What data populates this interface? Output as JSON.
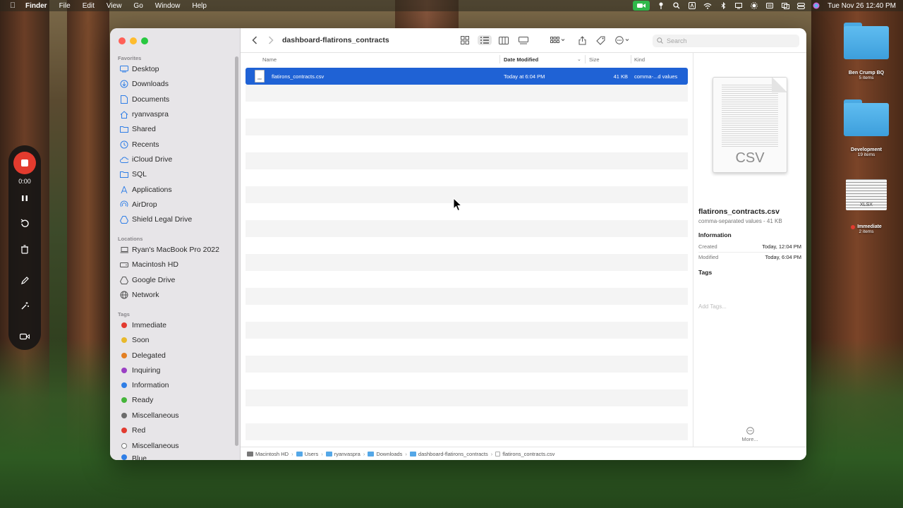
{
  "menubar": {
    "app": "Finder",
    "items": [
      "File",
      "Edit",
      "View",
      "Go",
      "Window",
      "Help"
    ],
    "clock": "Tue Nov 26  12:40 PM"
  },
  "recorder": {
    "timer": "0:00"
  },
  "finder": {
    "sidebar": {
      "favorites_header": "Favorites",
      "favorites": [
        "Desktop",
        "Downloads",
        "Documents",
        "ryanvaspra",
        "Shared",
        "Recents",
        "iCloud Drive",
        "SQL",
        "Applications",
        "AirDrop",
        "Shield Legal Drive"
      ],
      "locations_header": "Locations",
      "locations": [
        "Ryan's MacBook Pro 2022",
        "Macintosh HD",
        "Google Drive",
        "Network"
      ],
      "tags_header": "Tags",
      "tags": [
        {
          "label": "Immediate",
          "color": "#e23b30"
        },
        {
          "label": "Soon",
          "color": "#e8b92c"
        },
        {
          "label": "Delegated",
          "color": "#e37f22"
        },
        {
          "label": "Inquiring",
          "color": "#9b40c4"
        },
        {
          "label": "Information",
          "color": "#2f7ee6"
        },
        {
          "label": "Ready",
          "color": "#45b53a"
        },
        {
          "label": "Miscellaneous",
          "color": "#6c6c6c"
        },
        {
          "label": "Red",
          "color": "#e23b30"
        },
        {
          "label": "Miscellaneous",
          "color": "#ffffff"
        },
        {
          "label": "Blue",
          "color": "#2f7ee6"
        }
      ]
    },
    "toolbar": {
      "title": "dashboard-flatirons_contracts",
      "search_placeholder": "Search"
    },
    "columns": {
      "name": "Name",
      "date": "Date Modified",
      "size": "Size",
      "kind": "Kind"
    },
    "files": [
      {
        "name": "flatirons_contracts.csv",
        "date": "Today at 6:04 PM",
        "size": "41 KB",
        "kind": "comma-...d values",
        "selected": true
      }
    ],
    "pathbar": [
      "Macintosh HD",
      "Users",
      "ryanvaspra",
      "Downloads",
      "dashboard-flatirons_contracts",
      "flatirons_contracts.csv"
    ],
    "preview": {
      "thumb_label": "CSV",
      "name": "flatirons_contracts.csv",
      "subtitle": "comma-separated values - 41 KB",
      "info_header": "Information",
      "created_label": "Created",
      "created_value": "Today, 12:04 PM",
      "modified_label": "Modified",
      "modified_value": "Today, 6:04 PM",
      "tags_header": "Tags",
      "tags_placeholder": "Add Tags...",
      "more_label": "More..."
    }
  },
  "desktop": {
    "icons": [
      {
        "label": "Ben Crump BQ",
        "sub": "5 items"
      },
      {
        "label": "Development",
        "sub": "19 items"
      },
      {
        "label": "Immediate",
        "sub": "2 items",
        "thumb": "XLSX"
      }
    ]
  }
}
